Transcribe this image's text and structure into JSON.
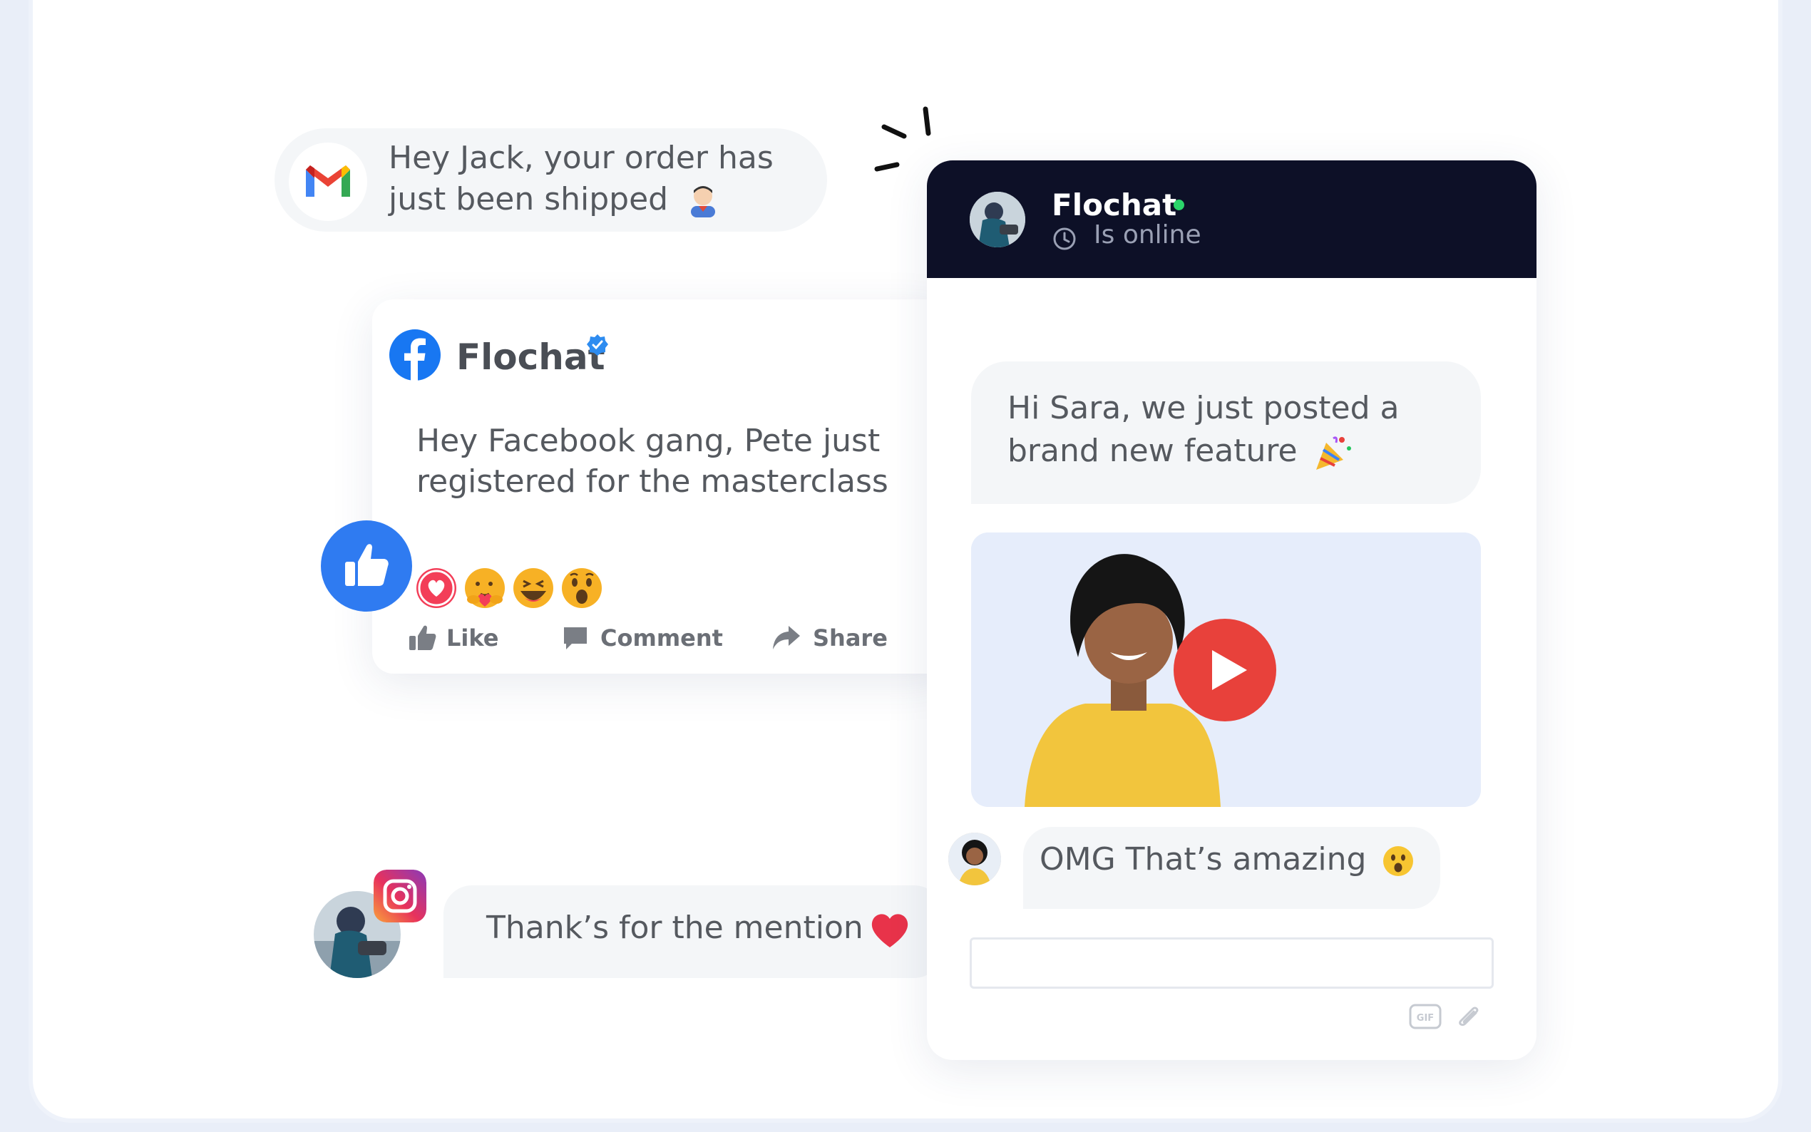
{
  "gmail": {
    "message": "Hey Jack, your order has just been shipped",
    "icon": "gmail-icon"
  },
  "facebook": {
    "page_name": "Flochat",
    "post": "Hey Facebook gang, Pete just registered for the masterclass",
    "actions": {
      "like": "Like",
      "comment": "Comment",
      "share": "Share"
    },
    "reactions": [
      "love",
      "care",
      "haha",
      "wow"
    ],
    "colors": {
      "brand": "#1877f2",
      "like_badge": "#2f7bf1"
    }
  },
  "instagram": {
    "message": "Thank’s for the mention",
    "icon": "instagram-icon"
  },
  "chat": {
    "title": "Flochat",
    "status": "Is online",
    "message_in": "Hi Sara, we just posted a brand new feature",
    "reply": "OMG That’s amazing",
    "input_value": "",
    "tools": {
      "gif": "GIF"
    },
    "colors": {
      "header": "#0d1027",
      "online": "#2bd46a",
      "play": "#e8413b"
    }
  }
}
